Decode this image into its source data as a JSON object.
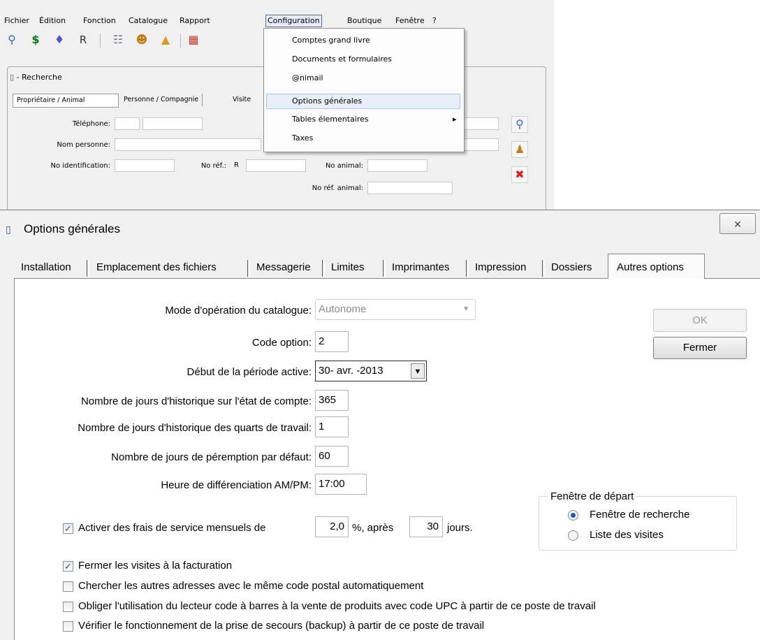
{
  "top_window": {
    "menu": [
      "Fichier",
      "Édition",
      "Fonction",
      "Catalogue",
      "Rapport",
      "Configuration",
      "Boutique",
      "Fenêtre",
      "?"
    ],
    "open_menu": "Configuration",
    "dropdown_items": [
      "Comptes grand livre",
      "Documents et formulaires",
      "@nimail",
      "Options générales",
      "Tables élementaires",
      "Taxes"
    ],
    "highlighted_item": "Options générales",
    "submenu_arrow": "▸",
    "search_title": "- Recherche",
    "search_tabs": [
      "Propriétaire / Animal",
      "Personne / Compagnie",
      "Visite"
    ],
    "labels": {
      "telephone": "Téléphone:",
      "nom_personne": "Nom personne:",
      "no_identification": "No identification:",
      "no_ref": "No réf.:",
      "no_ref_value": "R",
      "no_animal": "No animal:",
      "no_ref_animal": "No réf. animal:"
    },
    "icons": [
      "magnifier-icon",
      "dollar-icon",
      "pin-icon",
      "rx-icon",
      "cart-icon",
      "person-icon",
      "upload-icon",
      "calendar-icon"
    ]
  },
  "dialog": {
    "title": "Options générales",
    "close_glyph": "✕",
    "tabs": [
      "Installation",
      "Emplacement des fichiers",
      "Messagerie",
      "Limites",
      "Imprimantes",
      "Impression",
      "Dossiers",
      "Autres options"
    ],
    "active_tab": "Autres options",
    "fields": {
      "mode_label": "Mode d'opération du catalogue:",
      "mode_value": "Autonome",
      "code_label": "Code option:",
      "code_value": "2",
      "debut_label": "Début de la période active:",
      "debut_value": "30- avr. -2013",
      "hist_etat_label": "Nombre de jours d'historique sur l'état de compte:",
      "hist_etat_value": "365",
      "hist_quarts_label": "Nombre de jours d'historique des quarts de travail:",
      "hist_quarts_value": "1",
      "peremption_label": "Nombre de jours de péremption par défaut:",
      "peremption_value": "60",
      "heure_label": "Heure de différenciation AM/PM:",
      "heure_value": "17:00"
    },
    "buttons": {
      "ok": "OK",
      "fermer": "Fermer"
    },
    "service_fee": {
      "label": "Activer des frais de service mensuels de",
      "checked": true,
      "percent": "2,0",
      "after": "%, après",
      "days": "30",
      "days_label": "jours."
    },
    "start_window": {
      "title": "Fenêtre de départ",
      "options": [
        "Fenêtre de recherche",
        "Liste des visites"
      ],
      "selected": "Fenêtre de recherche"
    },
    "checkboxes": [
      {
        "label": "Fermer les visites à la facturation",
        "checked": true
      },
      {
        "label": "Chercher les autres adresses avec le même code postal automatiquement",
        "checked": false
      },
      {
        "label": "Obliger l'utilisation du lecteur code à barres à la vente de produits avec code UPC à partir de ce poste de travail",
        "checked": false
      },
      {
        "label": "Vérifier le fonctionnement de la prise de secours (backup) à partir de ce poste de travail",
        "checked": false
      }
    ],
    "check_glyph": "✓"
  }
}
